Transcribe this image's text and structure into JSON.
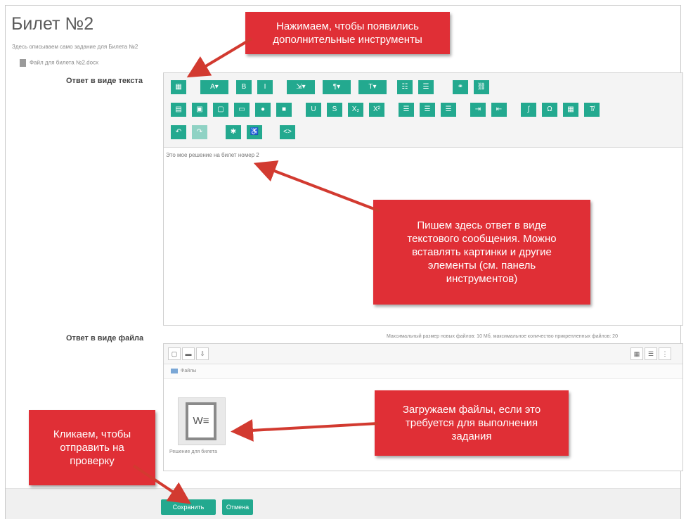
{
  "page": {
    "title": "Билет №2",
    "description": "Здесь описываем само задание для Билета №2",
    "attachment": "Файл для билета №2.docx"
  },
  "text_answer": {
    "label": "Ответ в виде текста",
    "content": "Это мое решение на билет номер 2",
    "toolbar_icons": {
      "row1": [
        "toggle-toolbar-icon",
        "font-icon",
        "bold-icon",
        "italic-icon",
        "style-icon",
        "paragraph-icon",
        "size-icon",
        "list-icon",
        "list-ordered-icon",
        "link-icon",
        "unlink-icon"
      ],
      "row2": [
        "image-icon",
        "media-icon",
        "save-icon",
        "paste-icon",
        "record-audio-icon",
        "record-video-icon",
        "underline-icon",
        "strikethrough-icon",
        "subscript-icon",
        "superscript-icon",
        "align-left-icon",
        "align-center-icon",
        "align-right-icon",
        "indent-icon",
        "outdent-icon",
        "equation-icon",
        "special-char-icon",
        "table-icon",
        "clear-format-icon"
      ],
      "row3": [
        "undo-icon",
        "redo-icon",
        "accessibility-icon",
        "screenreader-icon",
        "html-icon"
      ]
    }
  },
  "file_answer": {
    "label": "Ответ в виде файла",
    "limits_note": "Максимальный размер новых файлов: 10 Мб, максимальное количество прикрепленных файлов: 20",
    "folder": "Файлы",
    "file_name": "Решение для билета"
  },
  "buttons": {
    "save": "Сохранить",
    "cancel": "Отмена"
  },
  "callouts": {
    "tools": "Нажимаем, чтобы появились\nдополнительные инструменты",
    "text": "Пишем здесь ответ в виде\nтекстового сообщения. Можно\nвставлять картинки и другие\nэлементы (см. панель\nинструментов)",
    "files": "Загружаем файлы, если это\nтребуется для выполнения\nзадания",
    "submit": "Кликаем, чтобы\nотправить на\nпроверку"
  },
  "colors": {
    "accent": "#23a98f",
    "callout": "#e02f36"
  }
}
